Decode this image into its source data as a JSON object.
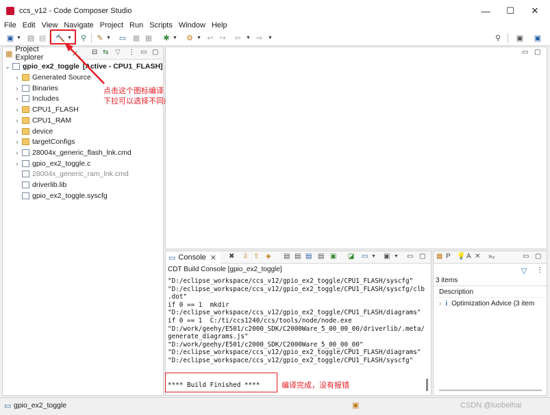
{
  "window": {
    "title": "ccs_v12 - Code Composer Studio",
    "minimize": "—",
    "maximize": "☐",
    "close": "✕"
  },
  "menu": [
    "File",
    "Edit",
    "View",
    "Navigate",
    "Project",
    "Run",
    "Scripts",
    "Window",
    "Help"
  ],
  "explorer": {
    "tab_label": "Project Explorer",
    "project": "gpio_ex2_toggle",
    "project_state": "[Active - CPU1_FLASH]",
    "items": [
      {
        "label": "Generated Source",
        "chevron": true,
        "icon": "folder",
        "dim": false
      },
      {
        "label": "Binaries",
        "chevron": true,
        "icon": "binaries",
        "dim": false
      },
      {
        "label": "Includes",
        "chevron": true,
        "icon": "includes",
        "dim": false
      },
      {
        "label": "CPU1_FLASH",
        "chevron": true,
        "icon": "folder",
        "dim": false
      },
      {
        "label": "CPU1_RAM",
        "chevron": true,
        "icon": "folder",
        "dim": false
      },
      {
        "label": "device",
        "chevron": true,
        "icon": "folder",
        "dim": false
      },
      {
        "label": "targetConfigs",
        "chevron": true,
        "icon": "folder",
        "dim": false
      },
      {
        "label": "28004x_generic_flash_lnk.cmd",
        "chevron": true,
        "icon": "cmd-file",
        "dim": false
      },
      {
        "label": "gpio_ex2_toggle.c",
        "chevron": true,
        "icon": "c-file",
        "dim": false
      },
      {
        "label": "28004x_generic_ram_lnk.cmd",
        "chevron": false,
        "icon": "cmd-file",
        "dim": true
      },
      {
        "label": "driverlib.lib",
        "chevron": false,
        "icon": "lib-file",
        "dim": false
      },
      {
        "label": "gpio_ex2_toggle.syscfg",
        "chevron": false,
        "icon": "syscfg-file",
        "dim": false
      }
    ]
  },
  "annotations": {
    "toolbar_note_line1": "点击这个图标编译，点击倒三角",
    "toolbar_note_line2": "下拉可以选择不同的工程配置",
    "build_note": "编译完成，没有报错"
  },
  "console": {
    "tab_label": "Console",
    "title": "CDT Build Console [gpio_ex2_toggle]",
    "lines": [
      "\"D:/eclipse_workspace/ccs_v12/gpio_ex2_toggle/CPU1_FLASH/syscfg\"",
      "\"D:/eclipse_workspace/ccs_v12/gpio_ex2_toggle/CPU1_FLASH/syscfg/clb",
      ".dot\"",
      "if 0 == 1  mkdir",
      "\"D:/eclipse_workspace/ccs_v12/gpio_ex2_toggle/CPU1_FLASH/diagrams\"",
      "if 0 == 1  C:/ti/ccs1240/ccs/tools/node/node.exe",
      "\"D:/work/geehy/E501/c2000_SDK/C2000Ware_5_00_00_00/driverlib/.meta/",
      "generate_diagrams.js\"",
      "\"D:/work/geehy/E501/c2000_SDK/C2000Ware_5_00_00_00\"",
      "\"D:/eclipse_workspace/ccs_v12/gpio_ex2_toggle/CPU1_FLASH/diagrams\"",
      "\"D:/eclipse_workspace/ccs_v12/gpio_ex2_toggle/CPU1_FLASH/syscfg\""
    ],
    "build_finished": "**** Build Finished ****"
  },
  "advice": {
    "tab_p": "P",
    "tab_a": "A",
    "overflow": "»₂",
    "count": "3 items",
    "column": "Description",
    "row": "Optimization Advice (3 item"
  },
  "status": {
    "project": "gpio_ex2_toggle",
    "watermark": "CSDN @luobeihai"
  },
  "colors": {
    "annotation_red": "#e41e26"
  }
}
